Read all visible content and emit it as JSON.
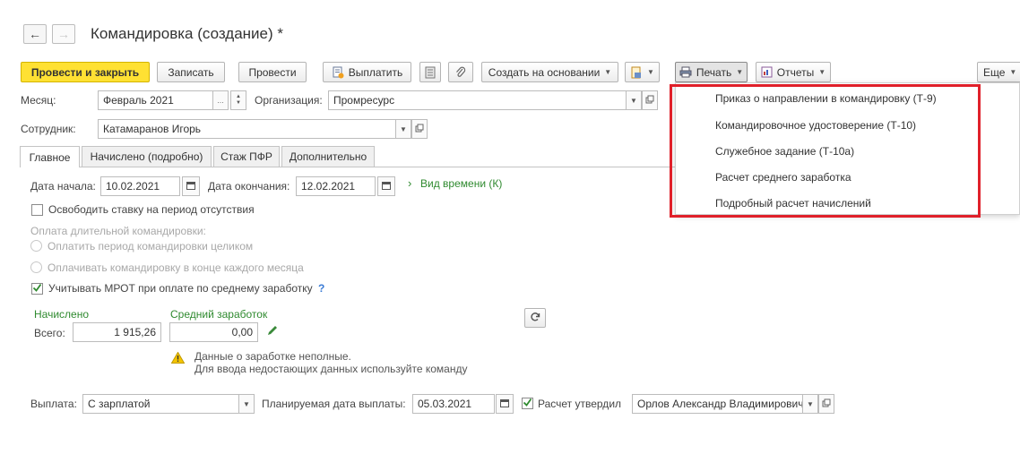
{
  "window": {
    "title": "Командировка (создание) *",
    "back_icon": "←",
    "forward_icon": "→"
  },
  "toolbar": {
    "post_close_label": "Провести и закрыть",
    "save_label": "Записать",
    "post_label": "Провести",
    "pay_label": "Выплатить",
    "create_based_label": "Создать на основании",
    "print_label": "Печать",
    "reports_label": "Отчеты",
    "more_label": "Еще"
  },
  "header": {
    "month_label": "Месяц:",
    "month_value": "Февраль 2021",
    "org_label": "Организация:",
    "org_value": "Промресурс",
    "employee_label": "Сотрудник:",
    "employee_value": "Катамаранов Игорь"
  },
  "tabs": [
    {
      "label": "Главное"
    },
    {
      "label": "Начислено (подробно)"
    },
    {
      "label": "Стаж ПФР"
    },
    {
      "label": "Дополнительно"
    }
  ],
  "main": {
    "start_label": "Дата начала:",
    "start_value": "10.02.2021",
    "end_label": "Дата окончания:",
    "end_value": "12.02.2021",
    "time_type_link": "Вид времени (К)",
    "free_rate_label": "Освободить ставку на период отсутствия",
    "long_pay_label": "Оплата длительной командировки:",
    "pay_whole_label": "Оплатить период командировки целиком",
    "pay_monthly_label": "Оплачивать командировку в конце каждого месяца",
    "mrot_label": "Учитывать МРОТ при оплате по среднему заработку",
    "help_mark": "?",
    "accrued_header": "Начислено",
    "avg_header": "Средний заработок",
    "total_label": "Всего:",
    "total_value": "1 915,26",
    "avg_value": "0,00",
    "warning_line1": "Данные о заработке неполные.",
    "warning_line2": "Для ввода недостающих данных используйте команду",
    "payout_label": "Выплата:",
    "payout_value": "С зарплатой",
    "planned_date_label": "Планируемая дата выплаты:",
    "planned_date_value": "05.03.2021",
    "approved_label": "Расчет утвердил",
    "approved_value": "Орлов Александр Владимирович"
  },
  "print_menu": {
    "items": [
      "Приказ о направлении в командировку (Т-9)",
      "Командировочное удостоверение (Т-10)",
      "Служебное задание (Т-10а)",
      "Расчет среднего заработка",
      "Подробный расчет начислений"
    ]
  },
  "colors": {
    "primary_button": "#ffe133",
    "accent_green": "#2f8a2f",
    "highlight_red": "#e0202a"
  }
}
